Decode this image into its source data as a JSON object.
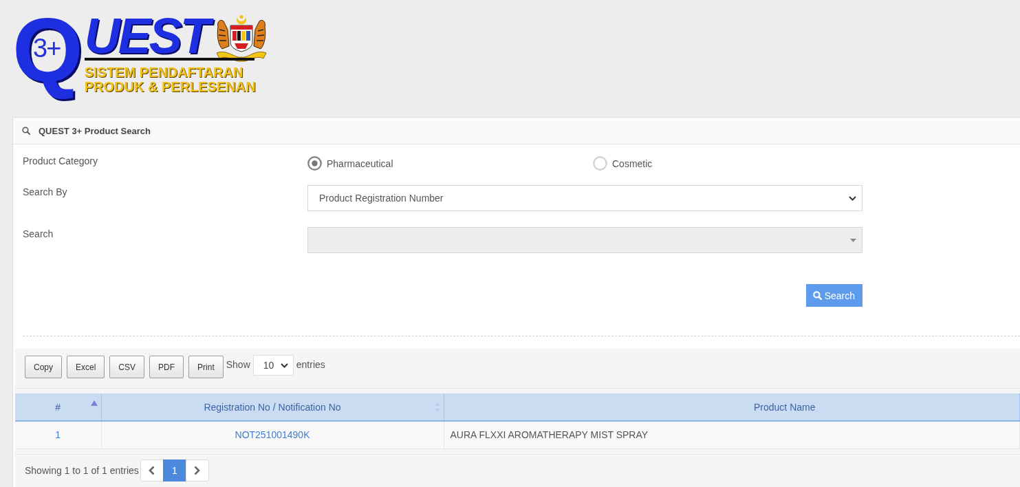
{
  "logo": {
    "letter": "Q",
    "version": "3+",
    "word": "UEST",
    "line_1": "SISTEM PENDAFTARAN",
    "line_2": "PRODUK & PERLESENAN"
  },
  "panel": {
    "title": "QUEST 3+ Product Search"
  },
  "form": {
    "category": {
      "label": "Product Category",
      "options": [
        {
          "label": "Pharmaceutical",
          "selected": true
        },
        {
          "label": "Cosmetic",
          "selected": false
        }
      ]
    },
    "search_by": {
      "label": "Search By",
      "value": "Product Registration Number"
    },
    "search": {
      "label": "Search",
      "disabled": true
    },
    "submit": {
      "label": "Search"
    }
  },
  "table": {
    "buttons": [
      "Copy",
      "Excel",
      "CSV",
      "PDF",
      "Print"
    ],
    "length": {
      "label_before": "Show",
      "value": "10",
      "label_after": "entries"
    },
    "columns": [
      {
        "label": "#",
        "sorted": true
      },
      {
        "label": "Registration No / Notification No",
        "sorted": false
      },
      {
        "label": "Product Name"
      }
    ],
    "rows": [
      {
        "index": "1",
        "registration_no": "NOT251001490K",
        "product_name": "AURA FLXXI AROMATHERAPY MIST SPRAY"
      }
    ],
    "info": "Showing 1 to 1 of 1 entries",
    "pagination": {
      "pages": [
        {
          "label": "1",
          "selected": true
        }
      ]
    }
  }
}
